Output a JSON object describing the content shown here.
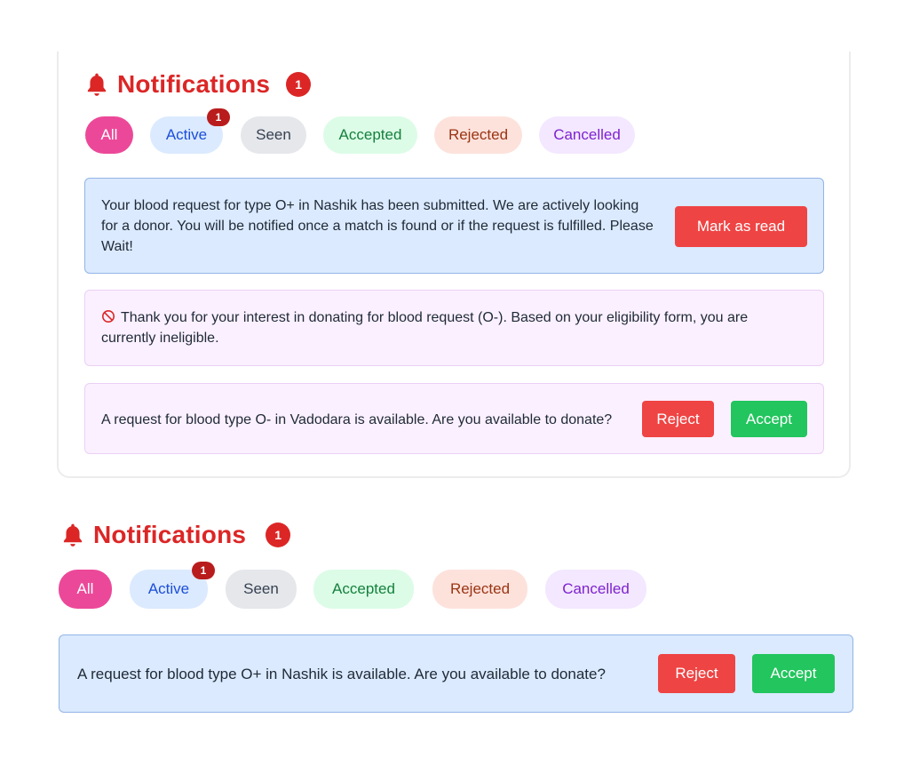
{
  "panels": [
    {
      "header": {
        "title": "Notifications",
        "count": "1"
      },
      "filters": [
        {
          "label": "All"
        },
        {
          "label": "Active",
          "badge": "1"
        },
        {
          "label": "Seen"
        },
        {
          "label": "Accepted"
        },
        {
          "label": "Rejected"
        },
        {
          "label": "Cancelled"
        }
      ],
      "notifications": [
        {
          "message": "Your blood request for type O+ in Nashik has been submitted. We are actively looking for a donor. You will be notified once a match is found or if the request is fulfilled. Please Wait!",
          "action": "Mark as read"
        },
        {
          "message": "Thank you for your interest in donating for blood request (O-). Based on your eligibility form, you are currently ineligible."
        },
        {
          "message": "A request for blood type O- in Vadodara is available. Are you available to donate?",
          "reject": "Reject",
          "accept": "Accept"
        }
      ]
    },
    {
      "header": {
        "title": "Notifications",
        "count": "1"
      },
      "filters": [
        {
          "label": "All"
        },
        {
          "label": "Active",
          "badge": "1"
        },
        {
          "label": "Seen"
        },
        {
          "label": "Accepted"
        },
        {
          "label": "Rejected"
        },
        {
          "label": "Cancelled"
        }
      ],
      "notifications": [
        {
          "message": "A request for blood type O+ in Nashik is available. Are you available to donate?",
          "reject": "Reject",
          "accept": "Accept"
        }
      ]
    }
  ],
  "icons": {
    "header": "bell-icon",
    "ineligible": "ban-icon"
  },
  "colors": {
    "accent": "#dc2626",
    "all_pill": "#ec4899",
    "active_pill": "#dbeafe",
    "accept_button": "#22c55e",
    "reject_button": "#ef4444"
  }
}
